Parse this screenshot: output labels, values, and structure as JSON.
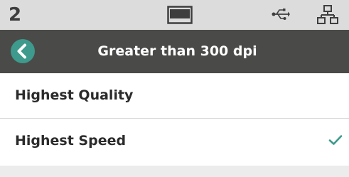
{
  "status_bar": {
    "page_number": "2",
    "icons": [
      "display-icon",
      "usb-icon",
      "network-icon"
    ]
  },
  "header": {
    "back_icon": "chevron-left-icon",
    "title": "Greater than 300 dpi"
  },
  "options": [
    {
      "label": "Highest Quality",
      "selected": false
    },
    {
      "label": "Highest Speed",
      "selected": true
    }
  ],
  "colors": {
    "status_bar_bg": "#dcdcdc",
    "header_bg": "#4a4a48",
    "accent": "#3d9a8c",
    "check": "#3d9a8c"
  }
}
